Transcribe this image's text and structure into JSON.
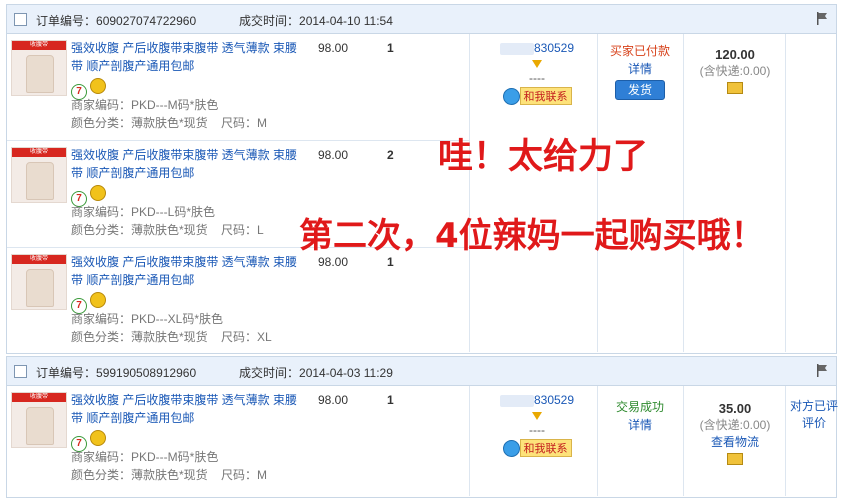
{
  "orders": [
    {
      "order_no_label": "订单编号：",
      "order_no": "609027074722960",
      "time_label": "成交时间：",
      "time": "2014-04-10 11:54",
      "seller_name": "830529",
      "seller_dash": "----",
      "chat_label": "和我联系",
      "status_text": "买家已付款",
      "status_detail": "详情",
      "status_button": "发货",
      "amount": "120.00",
      "shipping": "(含快递:0.00)",
      "items": [
        {
          "title": "强效收腹 产后收腹带束腹带 透气薄款 束腰带 顺产剖腹产通用包邮",
          "price": "98.00",
          "qty": "1",
          "code": "商家编码：PKD---M码*肤色",
          "color": "颜色分类：薄款肤色*现货",
          "size": "尺码：M"
        },
        {
          "title": "强效收腹 产后收腹带束腹带 透气薄款 束腰带 顺产剖腹产通用包邮",
          "price": "98.00",
          "qty": "2",
          "code": "商家编码：PKD---L码*肤色",
          "color": "颜色分类：薄款肤色*现货",
          "size": "尺码：L"
        },
        {
          "title": "强效收腹 产后收腹带束腹带 透气薄款 束腰带 顺产剖腹产通用包邮",
          "price": "98.00",
          "qty": "1",
          "code": "商家编码：PKD---XL码*肤色",
          "color": "颜色分类：薄款肤色*现货",
          "size": "尺码：XL"
        }
      ]
    },
    {
      "order_no_label": "订单编号：",
      "order_no": "599190508912960",
      "time_label": "成交时间：",
      "time": "2014-04-03 11:29",
      "seller_name": "830529",
      "seller_dash": "----",
      "chat_label": "和我联系",
      "status_text": "交易成功",
      "status_detail": "详情",
      "amount": "35.00",
      "shipping": "(含快递:0.00)",
      "logistics": "查看物流",
      "review": "对方已评",
      "review2": "评价",
      "items": [
        {
          "title": "强效收腹 产后收腹带束腹带 透气薄款 束腰带 顺产剖腹产通用包邮",
          "price": "98.00",
          "qty": "1",
          "code": "商家编码：PKD---M码*肤色",
          "color": "颜色分类：薄款肤色*现货",
          "size": "尺码：M"
        }
      ]
    }
  ],
  "overlay": {
    "line1": "哇！太给力了",
    "line2": "第二次，4位辣妈一起购买哦！"
  },
  "colors": {
    "overlay": "#e0191a",
    "link": "#1a58b6",
    "header_bg": "#e9f1fb"
  }
}
